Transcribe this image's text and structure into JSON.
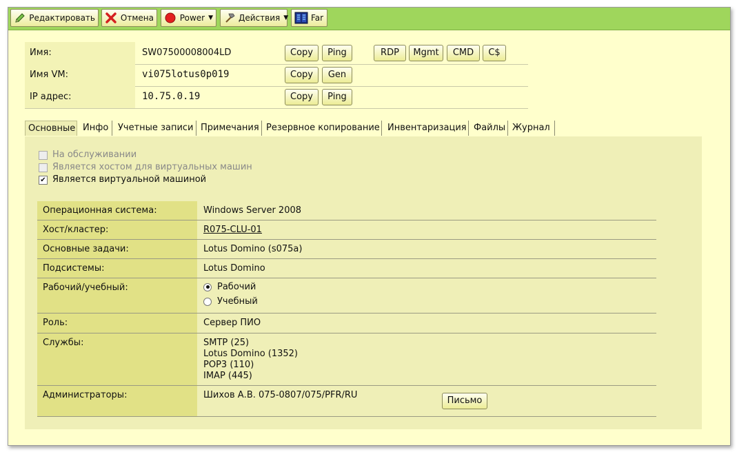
{
  "toolbar": {
    "edit_label": "Редактировать",
    "cancel_label": "Отмена",
    "power_label": "Power",
    "actions_label": "Действия",
    "far_label": "Far"
  },
  "info": {
    "rows": [
      {
        "label": "Имя:",
        "value": "SW07500008004LD"
      },
      {
        "label": "Имя VM:",
        "value": "vi075lotus0p019"
      },
      {
        "label": "IP адрес:",
        "value": "10.75.0.19"
      }
    ],
    "buttons": {
      "copy": "Copy",
      "ping": "Ping",
      "gen": "Gen",
      "rdp": "RDP",
      "mgmt": "Mgmt",
      "cmd": "CMD",
      "cs": "C$"
    }
  },
  "tabs": [
    "Основные",
    "Инфо",
    "Учетные записи",
    "Примечания",
    "Резервное копирование",
    "Инвентаризация",
    "Файлы",
    "Журнал"
  ],
  "checkboxes": [
    {
      "label": "На обслуживании",
      "checked": false,
      "disabled": true
    },
    {
      "label": "Является хостом для виртуальных машин",
      "checked": false,
      "disabled": true
    },
    {
      "label": "Является виртуальной машиной",
      "checked": true,
      "disabled": false
    }
  ],
  "details": {
    "os_label": "Операционная система:",
    "os_value": "Windows Server 2008",
    "host_label": "Хост/кластер:",
    "host_value": "R075-CLU-01",
    "tasks_label": "Основные задачи:",
    "tasks_value": "Lotus Domino (s075a)",
    "subsystems_label": "Подсистемы:",
    "subsystems_value": "Lotus Domino",
    "mode_label": "Рабочий/учебный:",
    "mode_options": [
      "Рабочий",
      "Учебный"
    ],
    "mode_selected": "Рабочий",
    "role_label": "Роль:",
    "role_value": "Сервер ПИО",
    "services_label": "Службы:",
    "services": [
      "SMTP (25)",
      "Lotus Domino (1352)",
      "POP3 (110)",
      "IMAP (445)"
    ],
    "admins_label": "Администраторы:",
    "admins_value": "Шихов А.В. 075-0807/075/PFR/RU",
    "mail_button": "Письмо"
  },
  "colors": {
    "toolbar_bg": "#9fd65c",
    "window_bg": "#ffffcc",
    "panel_bg": "#efefb7",
    "label_cell_bg": "#e1e186"
  }
}
